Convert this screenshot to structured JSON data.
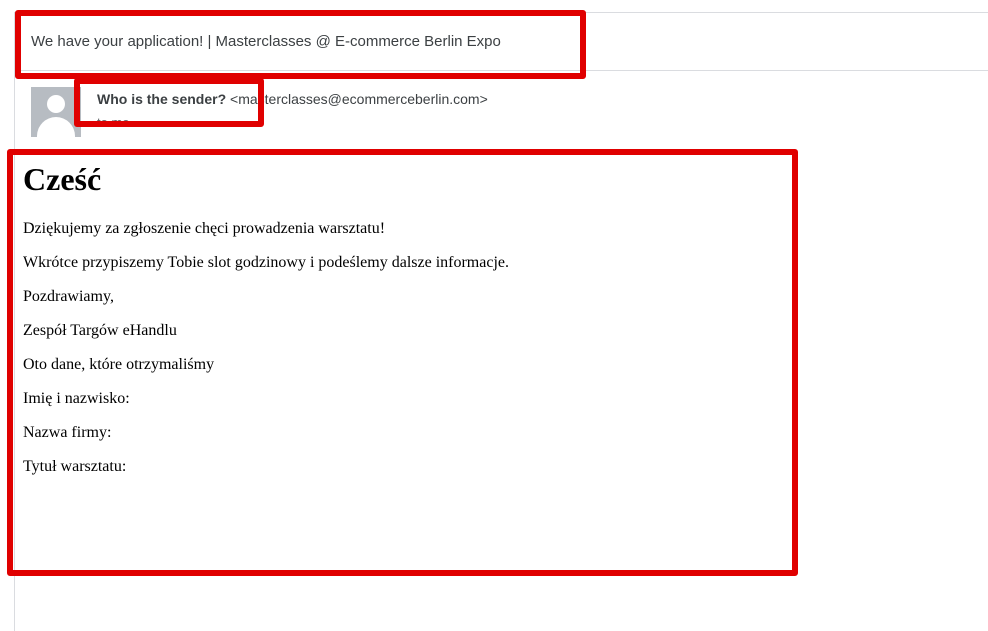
{
  "email": {
    "subject": "We have your application! | Masterclasses @ E-commerce Berlin Expo",
    "sender_name": "Who is the sender?",
    "sender_email": "<masterclasses@ecommerceberlin.com>",
    "to_line": "to me",
    "body": {
      "heading": "Cześć",
      "paragraphs": [
        "Dziękujemy za zgłoszenie chęci prowadzenia warsztatu!",
        "Wkrótce przypiszemy Tobie slot godzinowy i podeślemy dalsze informacje.",
        "Pozdrawiamy,",
        "Zespół Targów eHandlu",
        "Oto dane, które otrzymaliśmy",
        "Imię i nazwisko:",
        "Nazwa firmy:",
        "Tytuł warsztatu:"
      ]
    }
  },
  "icons": {
    "avatar": "default-user-avatar-icon"
  },
  "colors": {
    "annotation": "#e00000",
    "avatar_bg": "#b7bcc2",
    "divider": "#dadce0"
  }
}
